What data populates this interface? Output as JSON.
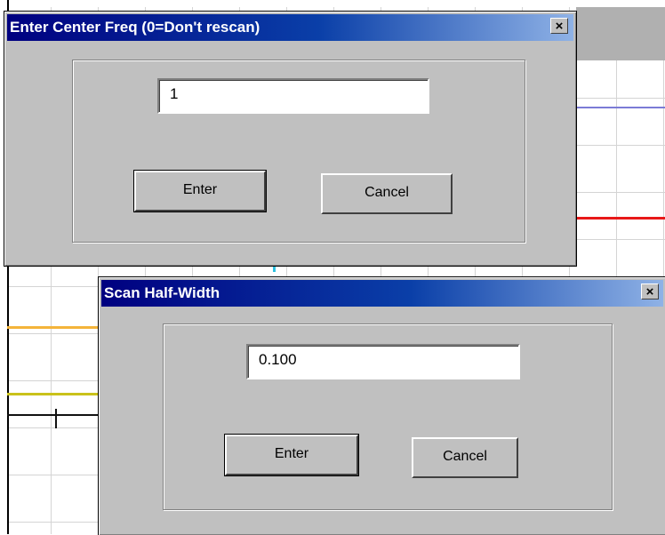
{
  "dialog_center_freq": {
    "title": "Enter Center Freq (0=Don't rescan)",
    "close_label": "×",
    "input_value": "1",
    "enter_label": "Enter",
    "cancel_label": "Cancel"
  },
  "dialog_half_width": {
    "title": "Scan Half-Width",
    "close_label": "×",
    "input_value": "0.100",
    "enter_label": "Enter",
    "cancel_label": "Cancel"
  },
  "colors": {
    "titlebar_start": "#000080",
    "titlebar_end": "#8fb2e6",
    "dialog_face": "#c0c0c0",
    "trace_blue": "#7b7bd6",
    "trace_red": "#e81818",
    "trace_orange": "#f4b43a",
    "trace_yellow": "#c9c21a"
  }
}
